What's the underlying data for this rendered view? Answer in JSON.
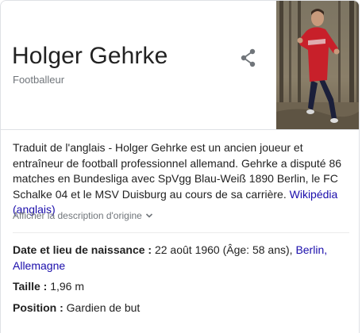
{
  "panel": {
    "title": "Holger Gehrke",
    "subtitle": "Footballeur",
    "share_icon": "share-icon",
    "photo_alt": "Holger Gehrke"
  },
  "description": {
    "text": "Traduit de l'anglais - Holger Gehrke est un ancien joueur et entraîneur de football professionnel allemand. Gehrke a disputé 86 matches en Bundesliga avec SpVgg Blau-Weiß 1890 Berlin, le FC Schalke 04 et le MSV Duisburg au cours de sa carrière.",
    "source_link": "Wikipédia (anglais)",
    "expand_label": "Afficher la description d'origine",
    "expand_icon": "chevron-down-icon"
  },
  "facts": {
    "birth": {
      "label": "Date et lieu de naissance :",
      "value": "22 août 1960 (Âge: 58 ans),",
      "place_link1": "Berlin,",
      "place_link2": "Allemagne"
    },
    "height": {
      "label": "Taille :",
      "value": "1,96 m"
    },
    "position": {
      "label": "Position :",
      "value": "Gardien de but"
    }
  },
  "colors": {
    "link": "#1a0dab",
    "muted": "#70757a",
    "text": "#222222",
    "border": "#dfe1e5"
  }
}
